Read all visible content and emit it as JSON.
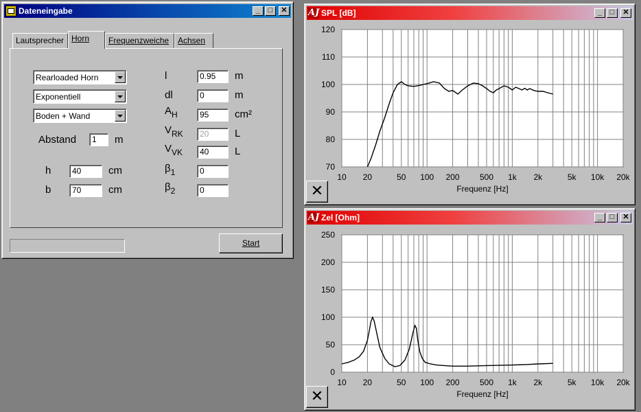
{
  "input_window": {
    "title": "Dateneingabe",
    "tabs": [
      "Lautsprecher",
      "Horn",
      "Frequenzweiche",
      "Achsen"
    ],
    "selected_tab": "Horn",
    "combos": [
      "Rearloaded Horn",
      "Exponentiell",
      "Boden + Wand"
    ],
    "abstand_label": "Abstand",
    "abstand_value": "1",
    "abstand_unit": "m",
    "h_label": "h",
    "h_value": "40",
    "h_unit": "cm",
    "b_label": "b",
    "b_value": "70",
    "b_unit": "cm",
    "params": [
      {
        "sym": "l",
        "sub": "",
        "value": "0.95",
        "unit": "m",
        "disabled": false
      },
      {
        "sym": "dl",
        "sub": "",
        "value": "0",
        "unit": "m",
        "disabled": false
      },
      {
        "sym": "A",
        "sub": "H",
        "value": "95",
        "unit": "cm²",
        "disabled": false
      },
      {
        "sym": "V",
        "sub": "RK",
        "value": "20",
        "unit": "L",
        "disabled": true
      },
      {
        "sym": "V",
        "sub": "VK",
        "value": "40",
        "unit": "L",
        "disabled": false
      },
      {
        "sym": "β",
        "sub": "1",
        "value": "0",
        "unit": "",
        "disabled": false
      },
      {
        "sym": "β",
        "sub": "2",
        "value": "0",
        "unit": "",
        "disabled": false
      }
    ],
    "start_label": "Start"
  },
  "title_buttons": {
    "minimize": "_",
    "maximize": "□",
    "close": "✕"
  },
  "close_chart_glyph": "✕",
  "chart_data": [
    {
      "type": "line",
      "title": "SPL [dB]",
      "xlabel": "Frequenz [Hz]",
      "x_scale": "log",
      "xlim": [
        10,
        20000
      ],
      "ylim": [
        70,
        120
      ],
      "xtick_labels": [
        "10",
        "20",
        "50",
        "100",
        "200",
        "500",
        "1k",
        "2k",
        "5k",
        "10k",
        "20k"
      ],
      "xtick_values": [
        10,
        20,
        50,
        100,
        200,
        500,
        1000,
        2000,
        5000,
        10000,
        20000
      ],
      "ytick_labels": [
        "70",
        "80",
        "90",
        "100",
        "110",
        "120"
      ],
      "grid": true,
      "series": [
        {
          "x": [
            20,
            22,
            25,
            28,
            32,
            36,
            40,
            45,
            50,
            55,
            60,
            70,
            80,
            100,
            120,
            140,
            160,
            180,
            200,
            230,
            260,
            300,
            350,
            400,
            450,
            500,
            550,
            600,
            650,
            700,
            800,
            900,
            1000,
            1100,
            1200,
            1300,
            1400,
            1500,
            1600,
            1800,
            2000,
            2300,
            2600,
            3000
          ],
          "y": [
            70,
            73,
            78,
            83,
            88,
            93,
            97,
            100,
            101,
            100,
            99.5,
            99.3,
            99.6,
            100.3,
            101,
            100.5,
            98.5,
            97.5,
            97.8,
            96.5,
            98,
            99.5,
            100.5,
            100.3,
            99.5,
            98.5,
            97.5,
            97,
            98,
            98.5,
            99.5,
            99,
            98,
            99,
            98.5,
            98,
            98.6,
            98,
            98.5,
            97.8,
            97.5,
            97.5,
            97,
            96.5
          ]
        }
      ]
    },
    {
      "type": "line",
      "title": "Zel [Ohm]",
      "xlabel": "Frequenz [Hz]",
      "x_scale": "log",
      "xlim": [
        10,
        20000
      ],
      "ylim": [
        0,
        250
      ],
      "xtick_labels": [
        "10",
        "20",
        "50",
        "100",
        "200",
        "500",
        "1k",
        "2k",
        "5k",
        "10k",
        "20k"
      ],
      "xtick_values": [
        10,
        20,
        50,
        100,
        200,
        500,
        1000,
        2000,
        5000,
        10000,
        20000
      ],
      "ytick_labels": [
        "0",
        "50",
        "100",
        "150",
        "200",
        "250"
      ],
      "grid": true,
      "series": [
        {
          "x": [
            10,
            12,
            14,
            16,
            18,
            20,
            21,
            22,
            23,
            24,
            26,
            28,
            32,
            36,
            42,
            48,
            55,
            62,
            68,
            72,
            75,
            78,
            82,
            88,
            95,
            110,
            130,
            160,
            200,
            300,
            500,
            1000,
            1500,
            2000,
            3000
          ],
          "y": [
            15,
            18,
            22,
            28,
            38,
            58,
            75,
            92,
            100,
            93,
            68,
            45,
            25,
            15,
            10,
            12,
            22,
            42,
            70,
            85,
            80,
            58,
            38,
            25,
            18,
            15,
            13,
            12,
            11,
            11,
            12,
            13,
            14,
            15,
            16
          ]
        }
      ]
    }
  ]
}
